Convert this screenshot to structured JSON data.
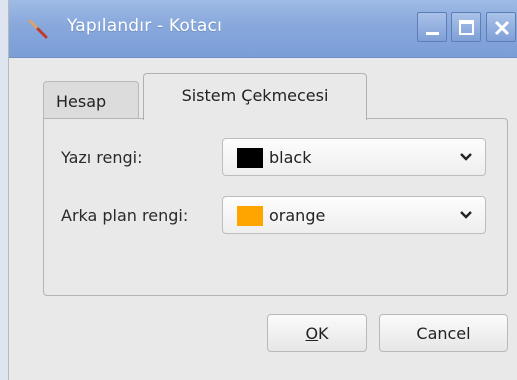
{
  "window": {
    "title": "Yapılandır - Kotacı",
    "icon": "screwdriver-icon",
    "controls": {
      "minimize": "minimize-icon",
      "maximize": "maximize-icon",
      "close": "close-icon"
    }
  },
  "tabs": [
    {
      "label": "Hesap",
      "active": false
    },
    {
      "label": "Sistem Çekmecesi",
      "active": true
    }
  ],
  "fields": {
    "text_color": {
      "label": "Yazı rengi:",
      "value": "black",
      "swatch": "#000000"
    },
    "bg_color": {
      "label": "Arka plan rengi:",
      "value": "orange",
      "swatch": "#ffa500"
    }
  },
  "buttons": {
    "ok_mnemonic": "O",
    "ok_rest": "K",
    "cancel": "Cancel"
  },
  "colors": {
    "titlebar": "#88a8dc",
    "window_bg": "#e9e9e9"
  }
}
